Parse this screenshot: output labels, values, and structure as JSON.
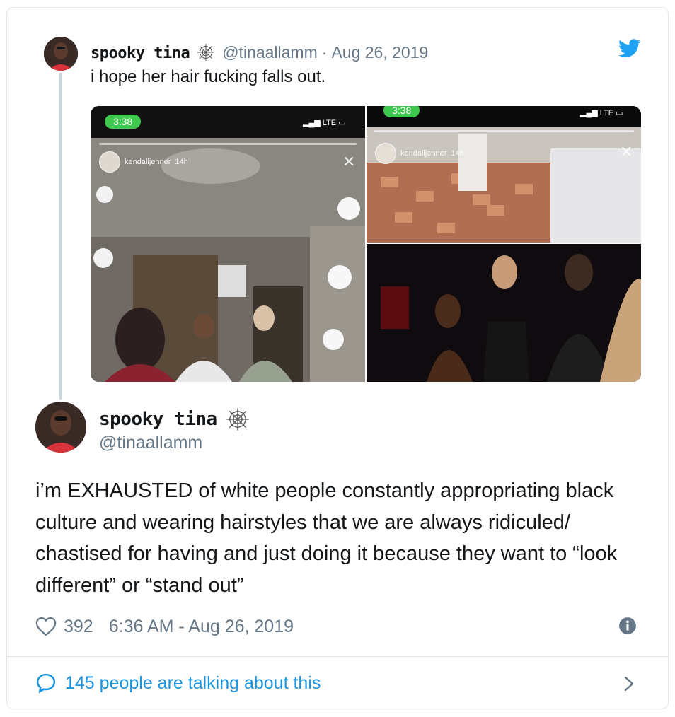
{
  "parent_tweet": {
    "display_name": "spooky tina",
    "handle": "@tinaallamm",
    "separator": "·",
    "date": "Aug 26, 2019",
    "text": "i hope her hair fucking falls out.",
    "media": [
      {
        "time": "3:38",
        "network": "LTE",
        "story_user": "kendalljenner",
        "story_age": "14h"
      },
      {
        "time": "3:38",
        "network": "LTE",
        "story_user": "kendalljenner",
        "story_age": "14h"
      }
    ]
  },
  "main_tweet": {
    "display_name": "spooky tina",
    "handle": "@tinaallamm",
    "text": "i’m EXHAUSTED of white people constantly appropriating black culture and wearing hairstyles that we are always ridiculed/ chastised for having and just doing it because they want to “look different” or “stand out”",
    "likes": "392",
    "timestamp": "6:36 AM - Aug 26, 2019"
  },
  "footer": {
    "talking_label": "145 people are talking about this"
  },
  "icons": {
    "brand": "twitter-bird-icon",
    "name_emoji": "spider-web-icon",
    "like": "heart-icon",
    "info": "info-icon",
    "reply": "speech-bubble-icon",
    "more": "chevron-right-icon"
  },
  "colors": {
    "twitter_blue": "#1da1f2",
    "link_blue": "#1b95e0",
    "secondary_text": "#657786",
    "primary_text": "#14171a",
    "border": "#e1e8ed",
    "status_green": "#3ec94e"
  }
}
